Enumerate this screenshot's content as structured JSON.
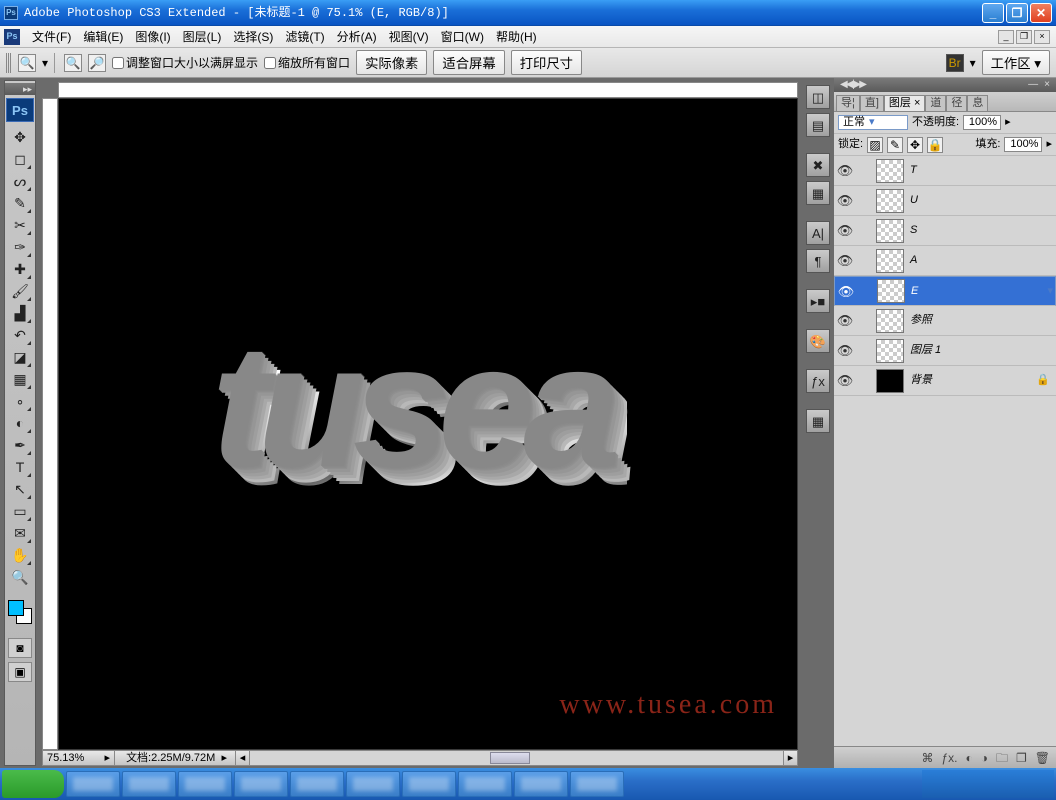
{
  "title": "Adobe Photoshop CS3 Extended - [未标题-1 @ 75.1% (E, RGB/8)]",
  "menu": [
    "文件(F)",
    "编辑(E)",
    "图像(I)",
    "图层(L)",
    "选择(S)",
    "滤镜(T)",
    "分析(A)",
    "视图(V)",
    "窗口(W)",
    "帮助(H)"
  ],
  "opt": {
    "chk1": "调整窗口大小以满屏显示",
    "chk2": "缩放所有窗口",
    "btn1": "实际像素",
    "btn2": "适合屏幕",
    "btn3": "打印尺寸",
    "ws": "工作区"
  },
  "status": {
    "zoom": "75.13%",
    "doc_label": "文档:",
    "doc_val": "2.25M/9.72M"
  },
  "panel": {
    "tabs": [
      "导¦",
      "直]",
      "图层 ×",
      "道",
      "径",
      "息"
    ],
    "blend": "正常",
    "opacity_label": "不透明度:",
    "opacity": "100%",
    "lock": "锁定:",
    "fill_label": "填充:",
    "fill": "100%",
    "layers": [
      {
        "name": "T",
        "sel": false,
        "trans": true
      },
      {
        "name": "U",
        "sel": false,
        "trans": true
      },
      {
        "name": "S",
        "sel": false,
        "trans": true
      },
      {
        "name": "A",
        "sel": false,
        "trans": true
      },
      {
        "name": "E",
        "sel": true,
        "trans": true
      },
      {
        "name": "参照",
        "sel": false,
        "trans": true
      },
      {
        "name": "图层 1",
        "sel": false,
        "trans": true
      },
      {
        "name": "背景",
        "sel": false,
        "trans": false,
        "locked": true
      }
    ]
  },
  "canvas": {
    "text": "tusea",
    "watermark": "www.tusea.com"
  },
  "tray_time": ""
}
